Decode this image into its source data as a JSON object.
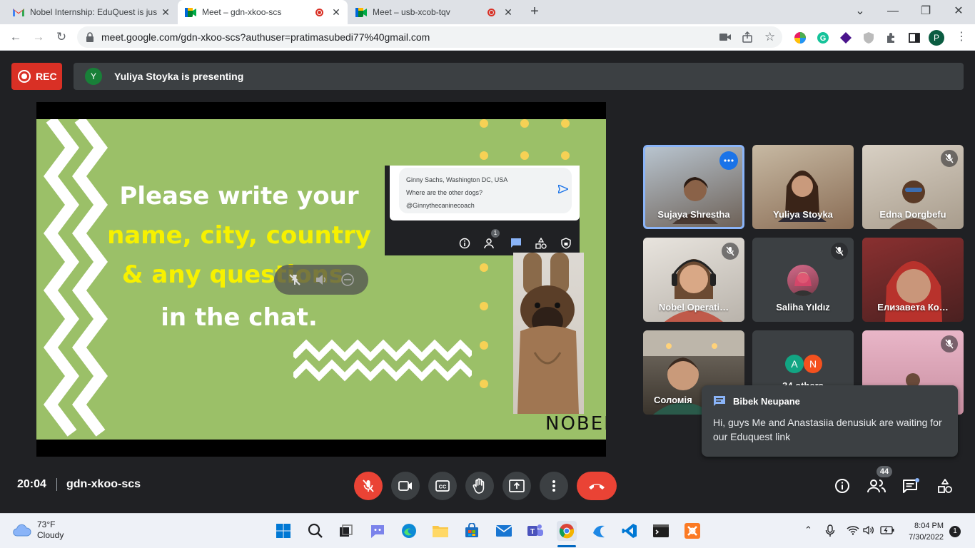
{
  "browser": {
    "tabs": [
      {
        "title": "Nobel Internship: EduQuest is jus",
        "icon": "gmail-icon",
        "active": false,
        "recording": false
      },
      {
        "title": "Meet – gdn-xkoo-scs",
        "icon": "meet-icon",
        "active": true,
        "recording": true
      },
      {
        "title": "Meet – usb-xcob-tqv",
        "icon": "meet-icon",
        "active": false,
        "recording": true
      }
    ],
    "url": "meet.google.com/gdn-xkoo-scs?authuser=pratimasubedi77%40gmail.com",
    "profile_initial": "P"
  },
  "meet": {
    "rec_label": "REC",
    "presenter_initial": "Y",
    "presenter_text": "Yuliya Stoyka is presenting",
    "slide": {
      "line1": "Please write your",
      "line2": "name, city, country",
      "line3": "& any questions",
      "line4": "in the chat.",
      "chat_name": "Ginny Sachs, Washington DC, USA",
      "chat_message": "Where are the other dogs?",
      "chat_handle": "@Ginnythecaninecoach",
      "people_badge": "1",
      "logo": "NOBEL"
    },
    "tiles": [
      {
        "name": "Sujaya Shrestha",
        "active": true,
        "muted": false
      },
      {
        "name": "Yuliya Stoyka",
        "active": false,
        "muted": false
      },
      {
        "name": "Edna Dorgbefu",
        "active": false,
        "muted": true
      },
      {
        "name": "Nobel Operati…",
        "active": false,
        "muted": true
      },
      {
        "name": "Saliha Yıldız",
        "active": false,
        "muted": true
      },
      {
        "name": "Елизавета Ко…",
        "active": false,
        "muted": false
      },
      {
        "name": "Соломія",
        "active": false,
        "muted": false
      },
      {
        "name": "34 others",
        "active": false,
        "muted": false
      },
      {
        "name": "",
        "active": false,
        "muted": true
      }
    ],
    "others_avatars": [
      "A",
      "N"
    ],
    "toast": {
      "sender": "Bibek Neupane",
      "message": "Hi, guys Me and Anastasiia denusiuk are waiting for our Eduquest link"
    },
    "time": "20:04",
    "meeting_code": "gdn-xkoo-scs",
    "participant_count": "44",
    "colors": {
      "rec": "#d93025",
      "end_call": "#ea4335",
      "slide_bg": "#9bc068",
      "slide_yellow": "#f7f100"
    }
  },
  "taskbar": {
    "temperature": "73°F",
    "condition": "Cloudy",
    "time": "8:04 PM",
    "date": "7/30/2022",
    "notifications": "1"
  }
}
